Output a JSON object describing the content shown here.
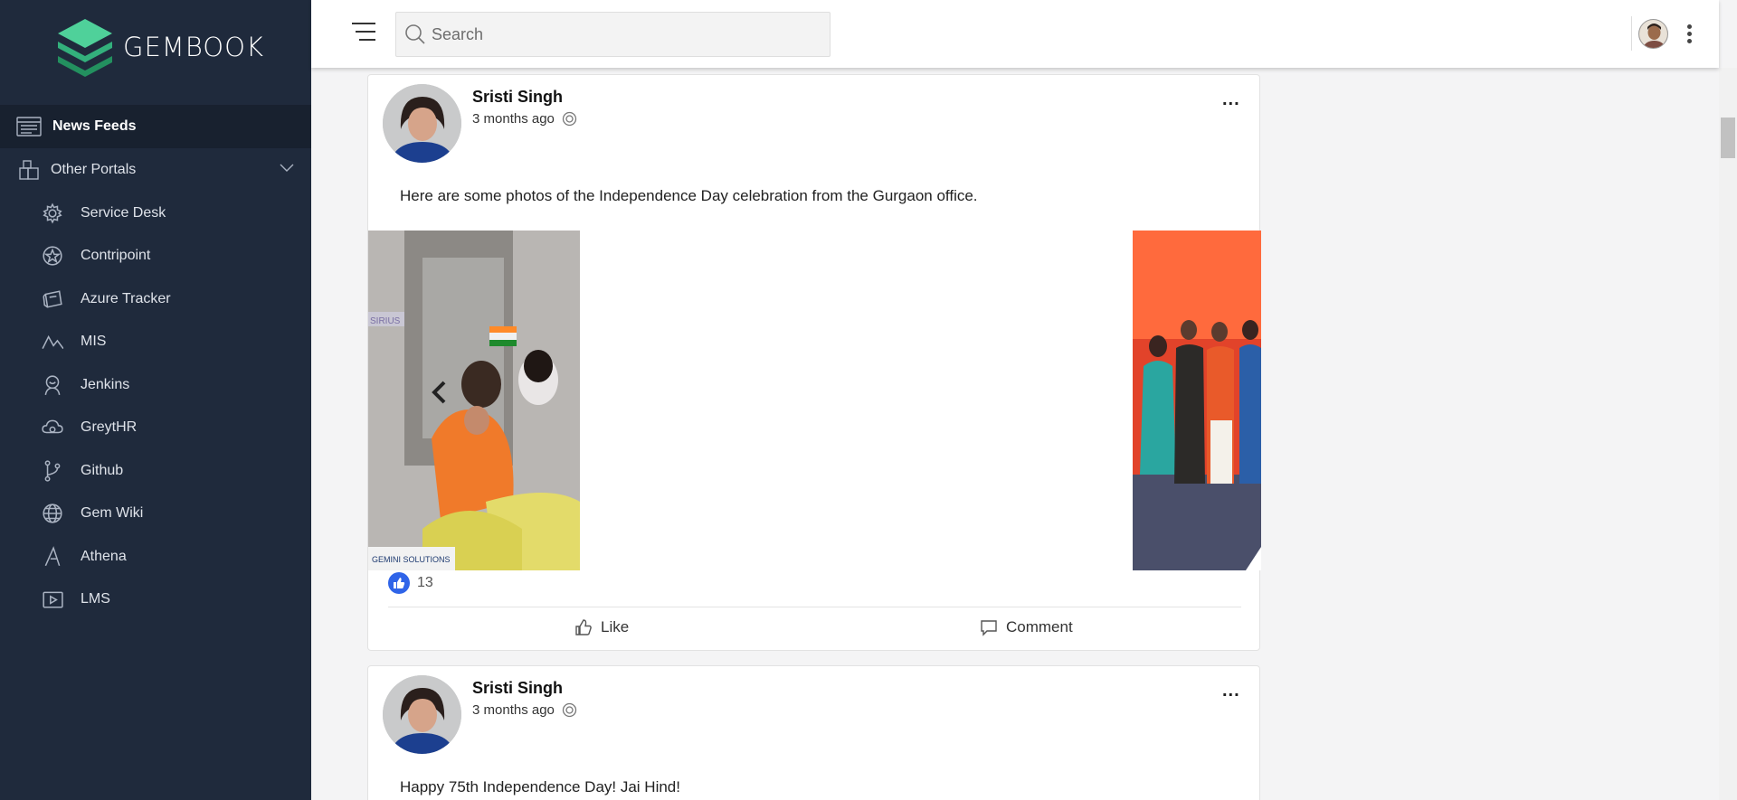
{
  "brand": {
    "name": "GEMBOOK"
  },
  "sidebar": {
    "active": {
      "label": "News Feeds",
      "icon": "newsfeed-icon"
    },
    "group": {
      "label": "Other Portals",
      "icon": "portals-icon"
    },
    "items": [
      {
        "label": "Service Desk",
        "icon": "gear-icon"
      },
      {
        "label": "Contripoint",
        "icon": "star-badge-icon"
      },
      {
        "label": "Azure Tracker",
        "icon": "tracker-icon"
      },
      {
        "label": "MIS",
        "icon": "chart-line-icon"
      },
      {
        "label": "Jenkins",
        "icon": "jenkins-icon"
      },
      {
        "label": "GreytHR",
        "icon": "cloud-icon"
      },
      {
        "label": "Github",
        "icon": "git-branch-icon"
      },
      {
        "label": "Gem Wiki",
        "icon": "globe-icon"
      },
      {
        "label": "Athena",
        "icon": "triangle-icon"
      },
      {
        "label": "LMS",
        "icon": "play-screen-icon"
      }
    ]
  },
  "topbar": {
    "search_placeholder": "Search"
  },
  "posts": [
    {
      "author": "Sristi Singh",
      "time": "3 months ago",
      "more": "...",
      "text": "Here are some photos of the Independence Day celebration from the Gurgaon office.",
      "photo_caption": "GEMINI SOLUTIONS",
      "likes": "13",
      "actions": {
        "like": "Like",
        "comment": "Comment"
      }
    },
    {
      "author": "Sristi Singh",
      "time": "3 months ago",
      "more": "...",
      "text": "Happy 75th Independence Day! Jai Hind!"
    }
  ],
  "colors": {
    "sidebar_bg": "#1f2a3c",
    "sidebar_active_bg": "#18212f",
    "like_badge": "#2f64e8",
    "logo_green": "#3fc28a"
  }
}
